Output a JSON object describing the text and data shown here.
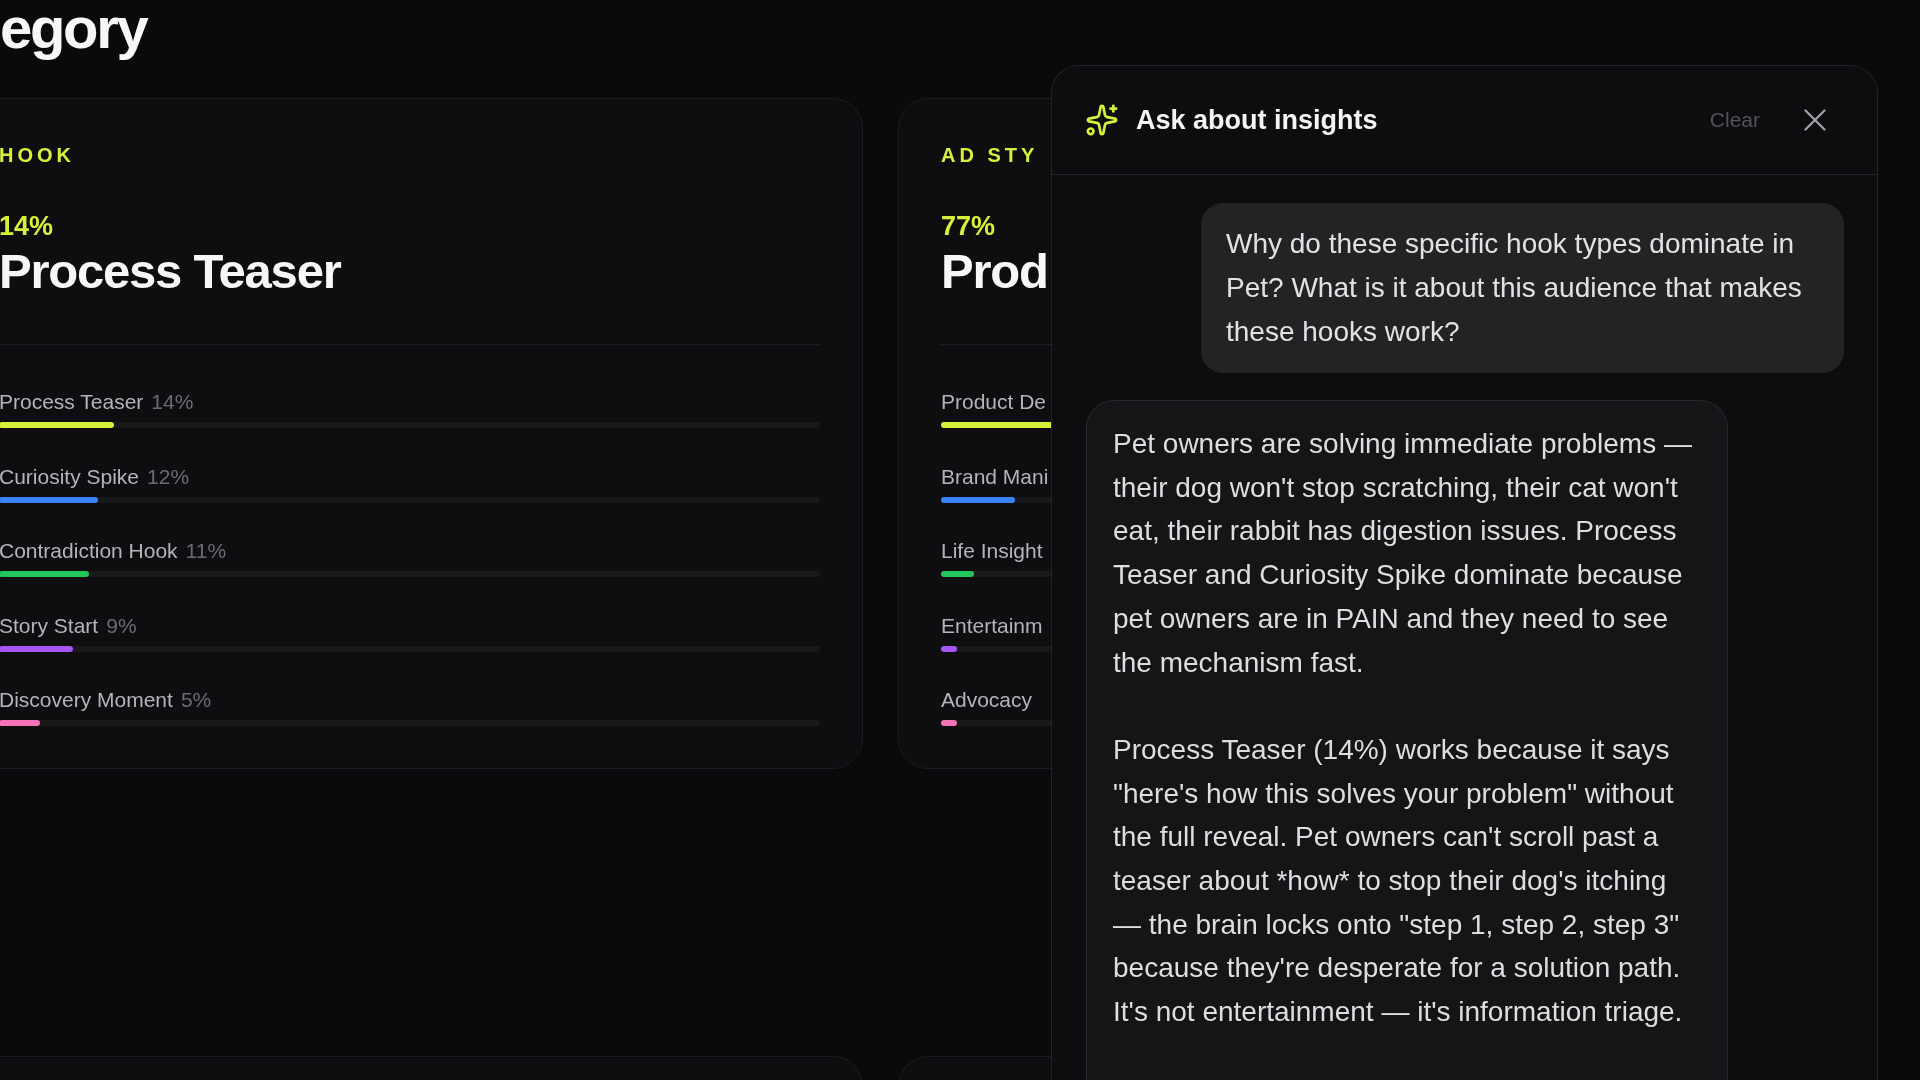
{
  "page_title": "egory",
  "cards": [
    {
      "label": "HOOK",
      "share": "14%",
      "top_name": "Process Teaser",
      "bars": [
        {
          "label": "Process Teaser",
          "value": "14%",
          "level": 0.14,
          "color": "#d9f03b"
        },
        {
          "label": "Curiosity Spike",
          "value": "12%",
          "level": 0.12,
          "color": "#3b82f6"
        },
        {
          "label": "Contradiction Hook",
          "value": "11%",
          "level": 0.11,
          "color": "#22c55e"
        },
        {
          "label": "Story Start",
          "value": "9%",
          "level": 0.09,
          "color": "#a855f7"
        },
        {
          "label": "Discovery Moment",
          "value": "5%",
          "level": 0.05,
          "color": "#f472b6"
        }
      ]
    },
    {
      "label": "AD STY",
      "share": "77%",
      "top_name": "Prod",
      "bars": [
        {
          "label": "Product De",
          "level": 0.77,
          "color": "#d9f03b"
        },
        {
          "label": "Brand Mani",
          "level": 0.09,
          "color": "#3b82f6"
        },
        {
          "label": "Life Insight",
          "level": 0.04,
          "color": "#22c55e"
        },
        {
          "label": "Entertainm",
          "level": 0.02,
          "color": "#a855f7"
        },
        {
          "label": "Advocacy",
          "level": 0.02,
          "color": "#f472b6"
        }
      ]
    }
  ],
  "chat": {
    "title": "Ask about insights",
    "clear": "Clear",
    "messages": [
      {
        "kind": "user",
        "paragraphs": [
          "Why do these specific hook types dominate in Pet? What is it about this audience that makes these hooks work?"
        ]
      },
      {
        "kind": "assistant",
        "paragraphs": [
          "Pet owners are solving immediate problems — their dog won't stop scratching, their cat won't eat, their rabbit has digestion issues. Process Teaser and Curiosity Spike dominate because pet owners are in PAIN and they need to see the mechanism fast.",
          "Process Teaser (14%) works because it says \"here's how this solves your problem\" without the full reveal. Pet owners can't scroll past a teaser about *how* to stop their dog's itching — the brain locks onto \"step 1, step 2, step 3\" because they're desperate for a solution path. It's not entertainment — it's information triage."
        ]
      }
    ]
  }
}
